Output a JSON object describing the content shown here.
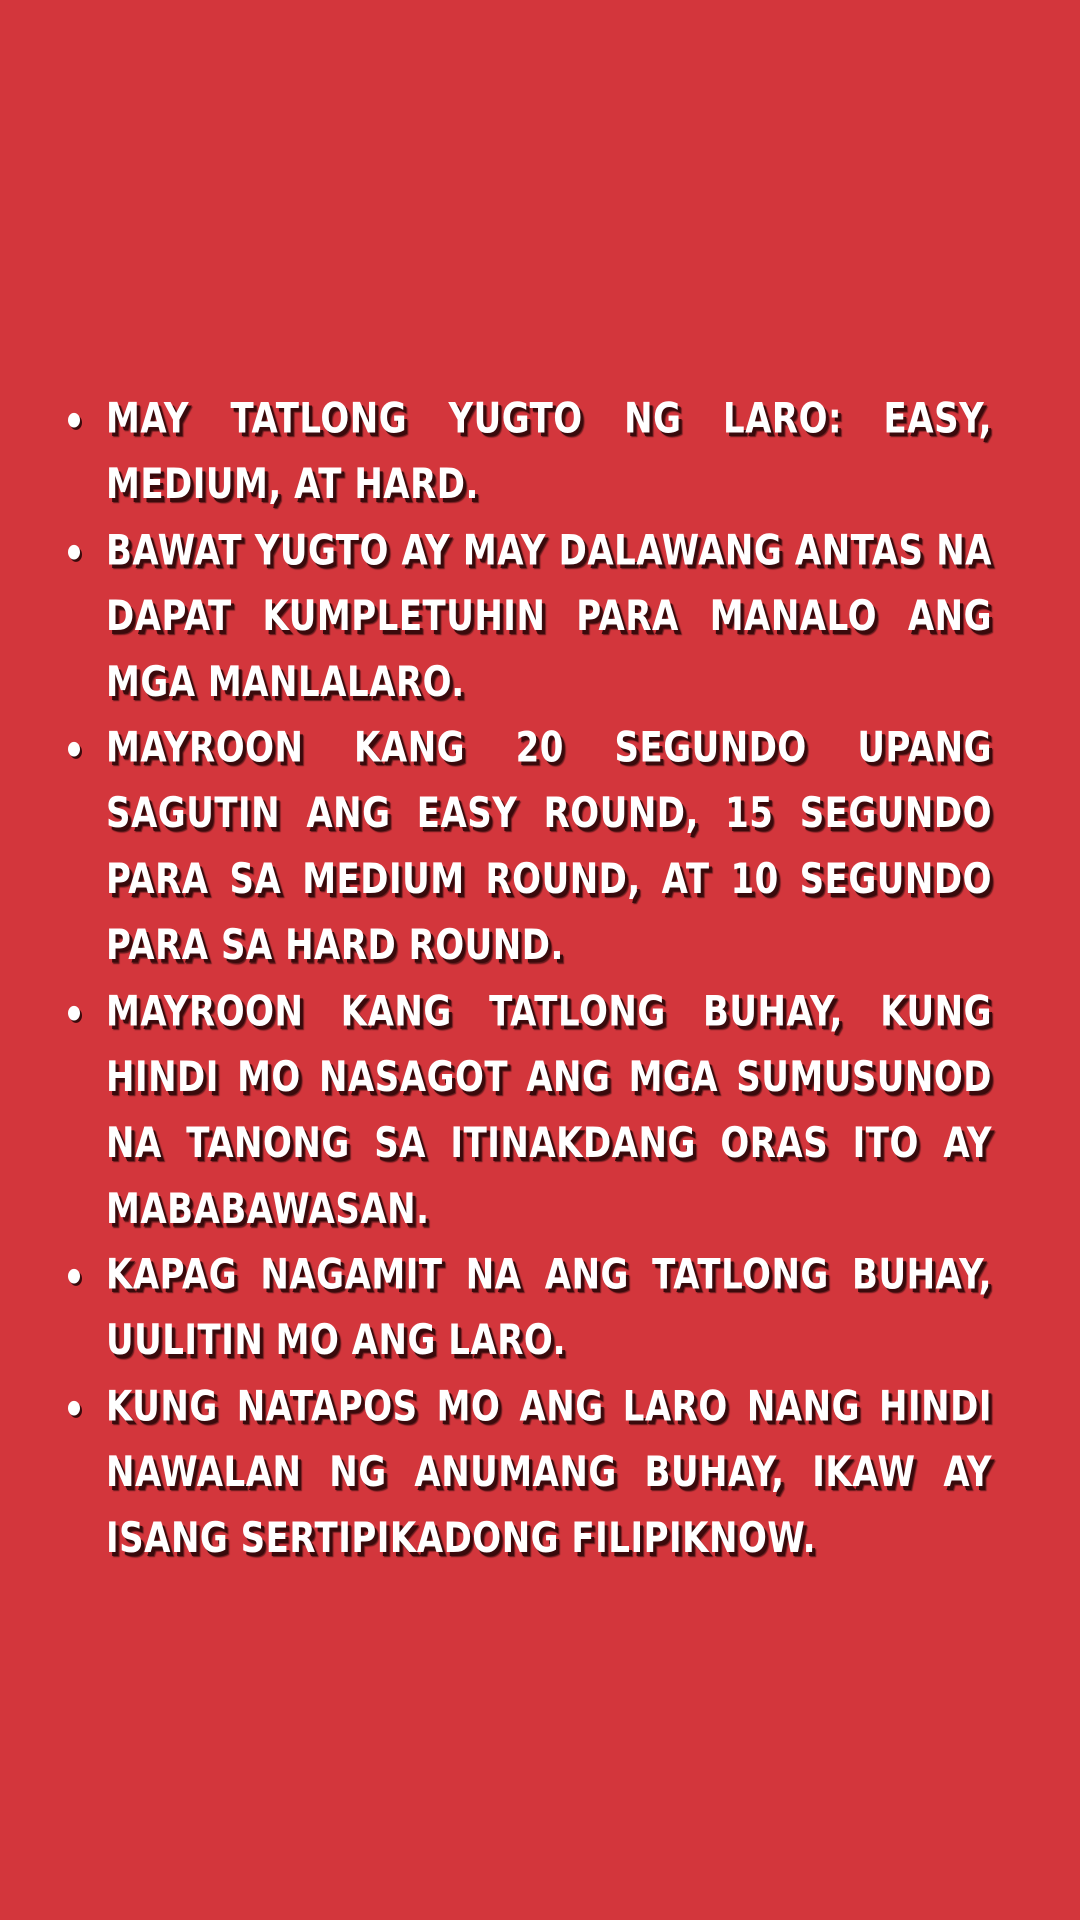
{
  "theme": {
    "background": "#d3363c",
    "text": "#ffffff",
    "shadow": "#3a0a0c"
  },
  "rules": {
    "items": [
      "May tatlong yugto ng laro: Easy, Medium, at Hard.",
      "Bawat yugto ay may dalawang antas na dapat kumpletuhin para manalo ang mga manlalaro.",
      "Mayroon kang 20 segundo upang sagutin ang easy round, 15 segundo para sa medium round, at 10 segundo para sa hard round.",
      "Mayroon kang tatlong buhay, kung hindi mo nasagot ang mga sumusunod na tanong sa itinakdang oras ito ay mababawasan.",
      "Kapag nagamit na ang tatlong buhay, uulitin mo ang laro.",
      "Kung natapos mo ang laro nang hindi nawalan ng anumang buhay, ikaw ay isang sertipikadong FILIPIKNOW."
    ]
  }
}
